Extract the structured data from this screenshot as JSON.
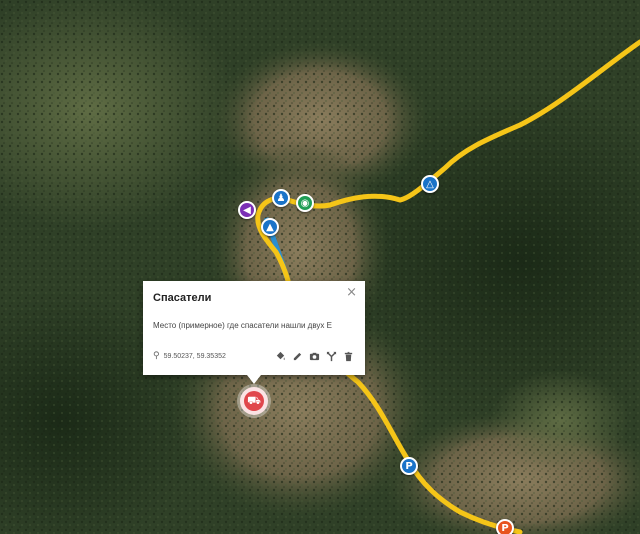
{
  "map": {
    "type": "satellite",
    "route_color": "#f5c518",
    "water_color": "#2a8fd0"
  },
  "markers": [
    {
      "icon": "hiker-icon",
      "color": "#1a73c8",
      "glyph": "♟"
    },
    {
      "icon": "camera-icon",
      "color": "#1f9d55",
      "glyph": "◉"
    },
    {
      "icon": "megaphone-icon",
      "color": "#7b2fb5",
      "glyph": "◀"
    },
    {
      "icon": "mountain-icon",
      "color": "#1a73c8",
      "glyph": "▲"
    },
    {
      "icon": "camp-tent-icon",
      "color": "#1a73c8",
      "glyph": "△"
    },
    {
      "icon": "parking-icon",
      "color": "#1a73c8",
      "glyph": "P"
    },
    {
      "icon": "parking-icon",
      "color": "#e8541e",
      "glyph": "P"
    }
  ],
  "selected_marker": {
    "icon": "rescue-vehicle-icon",
    "color": "#e0474c",
    "glyph": "⛟"
  },
  "popup": {
    "title": "Спасатели",
    "description": "Место (примерное) где спасатели нашли двух Е",
    "coordinates": "59.50237, 59.35352",
    "close_glyph": "×",
    "location_glyph": "⚲",
    "tools": [
      "paint-bucket-icon",
      "pencil-icon",
      "camera-icon",
      "directions-icon",
      "trash-icon"
    ]
  }
}
